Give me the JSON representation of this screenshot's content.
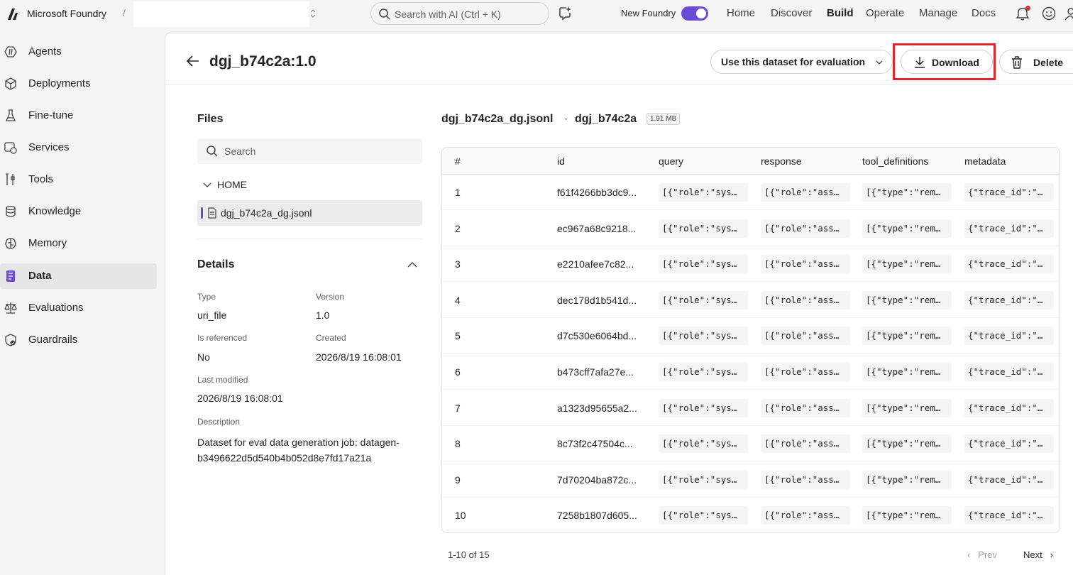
{
  "topbar": {
    "brand": "Microsoft Foundry",
    "separator": "/",
    "search_placeholder": "Search with AI (Ctrl + K)",
    "new_foundry_label": "New Foundry",
    "nav": [
      "Home",
      "Discover",
      "Build",
      "Operate",
      "Manage",
      "Docs"
    ],
    "active_nav": "Build"
  },
  "sidebar": {
    "items": [
      {
        "label": "Agents",
        "icon": "agents-icon"
      },
      {
        "label": "Deployments",
        "icon": "cube-icon"
      },
      {
        "label": "Fine-tune",
        "icon": "flask-icon"
      },
      {
        "label": "Services",
        "icon": "services-icon"
      },
      {
        "label": "Tools",
        "icon": "tools-icon"
      },
      {
        "label": "Knowledge",
        "icon": "database-icon"
      },
      {
        "label": "Memory",
        "icon": "brain-icon"
      },
      {
        "label": "Data",
        "icon": "data-icon"
      },
      {
        "label": "Evaluations",
        "icon": "scale-icon"
      },
      {
        "label": "Guardrails",
        "icon": "shield-icon"
      }
    ],
    "active": "Data"
  },
  "header": {
    "title": "dgj_b74c2a:1.0",
    "eval_button": "Use this dataset for evaluation",
    "download_button": "Download",
    "delete_button": "Delete"
  },
  "files": {
    "title": "Files",
    "search_placeholder": "Search",
    "folder": "HOME",
    "file": "dgj_b74c2a_dg.jsonl"
  },
  "details": {
    "title": "Details",
    "type_label": "Type",
    "type_value": "uri_file",
    "version_label": "Version",
    "version_value": "1.0",
    "referenced_label": "Is referenced",
    "referenced_value": "No",
    "created_label": "Created",
    "created_value": "2026/8/19 16:08:01",
    "modified_label": "Last modified",
    "modified_value": "2026/8/19 16:08:01",
    "description_label": "Description",
    "description_value": "Dataset for eval data generation job: datagen-b3496622d5d540b4b052d8e7fd17a21a"
  },
  "file_view": {
    "file_name": "dgj_b74c2a_dg.jsonl",
    "dot": "·",
    "dataset": "dgj_b74c2a",
    "size": "1.91 MB"
  },
  "table": {
    "columns": [
      "#",
      "id",
      "query",
      "response",
      "tool_definitions",
      "metadata"
    ],
    "rows": [
      {
        "n": "1",
        "id": "f61f4266bb3dc9...",
        "query": "[{\"role\":\"sys…",
        "response": "[{\"role\":\"ass…",
        "tools": "[{\"type\":\"rem…",
        "meta": "{\"trace_id\":\"…"
      },
      {
        "n": "2",
        "id": "ec967a68c9218...",
        "query": "[{\"role\":\"sys…",
        "response": "[{\"role\":\"ass…",
        "tools": "[{\"type\":\"rem…",
        "meta": "{\"trace_id\":\"…"
      },
      {
        "n": "3",
        "id": "e2210afee7c82...",
        "query": "[{\"role\":\"sys…",
        "response": "[{\"role\":\"ass…",
        "tools": "[{\"type\":\"rem…",
        "meta": "{\"trace_id\":\"…"
      },
      {
        "n": "4",
        "id": "dec178d1b541d...",
        "query": "[{\"role\":\"sys…",
        "response": "[{\"role\":\"ass…",
        "tools": "[{\"type\":\"rem…",
        "meta": "{\"trace_id\":\"…"
      },
      {
        "n": "5",
        "id": "d7c530e6064bd...",
        "query": "[{\"role\":\"sys…",
        "response": "[{\"role\":\"ass…",
        "tools": "[{\"type\":\"rem…",
        "meta": "{\"trace_id\":\"…"
      },
      {
        "n": "6",
        "id": "b473cff7afa27e...",
        "query": "[{\"role\":\"sys…",
        "response": "[{\"role\":\"ass…",
        "tools": "[{\"type\":\"rem…",
        "meta": "{\"trace_id\":\"…"
      },
      {
        "n": "7",
        "id": "a1323d95655a2...",
        "query": "[{\"role\":\"sys…",
        "response": "[{\"role\":\"ass…",
        "tools": "[{\"type\":\"rem…",
        "meta": "{\"trace_id\":\"…"
      },
      {
        "n": "8",
        "id": "8c73f2c47504c...",
        "query": "[{\"role\":\"sys…",
        "response": "[{\"role\":\"ass…",
        "tools": "[{\"type\":\"rem…",
        "meta": "{\"trace_id\":\"…"
      },
      {
        "n": "9",
        "id": "7d70204ba872c...",
        "query": "[{\"role\":\"sys…",
        "response": "[{\"role\":\"ass…",
        "tools": "[{\"type\":\"rem…",
        "meta": "{\"trace_id\":\"…"
      },
      {
        "n": "10",
        "id": "7258b1807d605...",
        "query": "[{\"role\":\"sys…",
        "response": "[{\"role\":\"ass…",
        "tools": "[{\"type\":\"rem…",
        "meta": "{\"trace_id\":\"…"
      }
    ]
  },
  "pager": {
    "info": "1-10 of 15",
    "prev": "Prev",
    "next": "Next"
  },
  "colors": {
    "accent": "#6b4bd8",
    "highlight": "#e0262f",
    "notification": "#d13438"
  }
}
